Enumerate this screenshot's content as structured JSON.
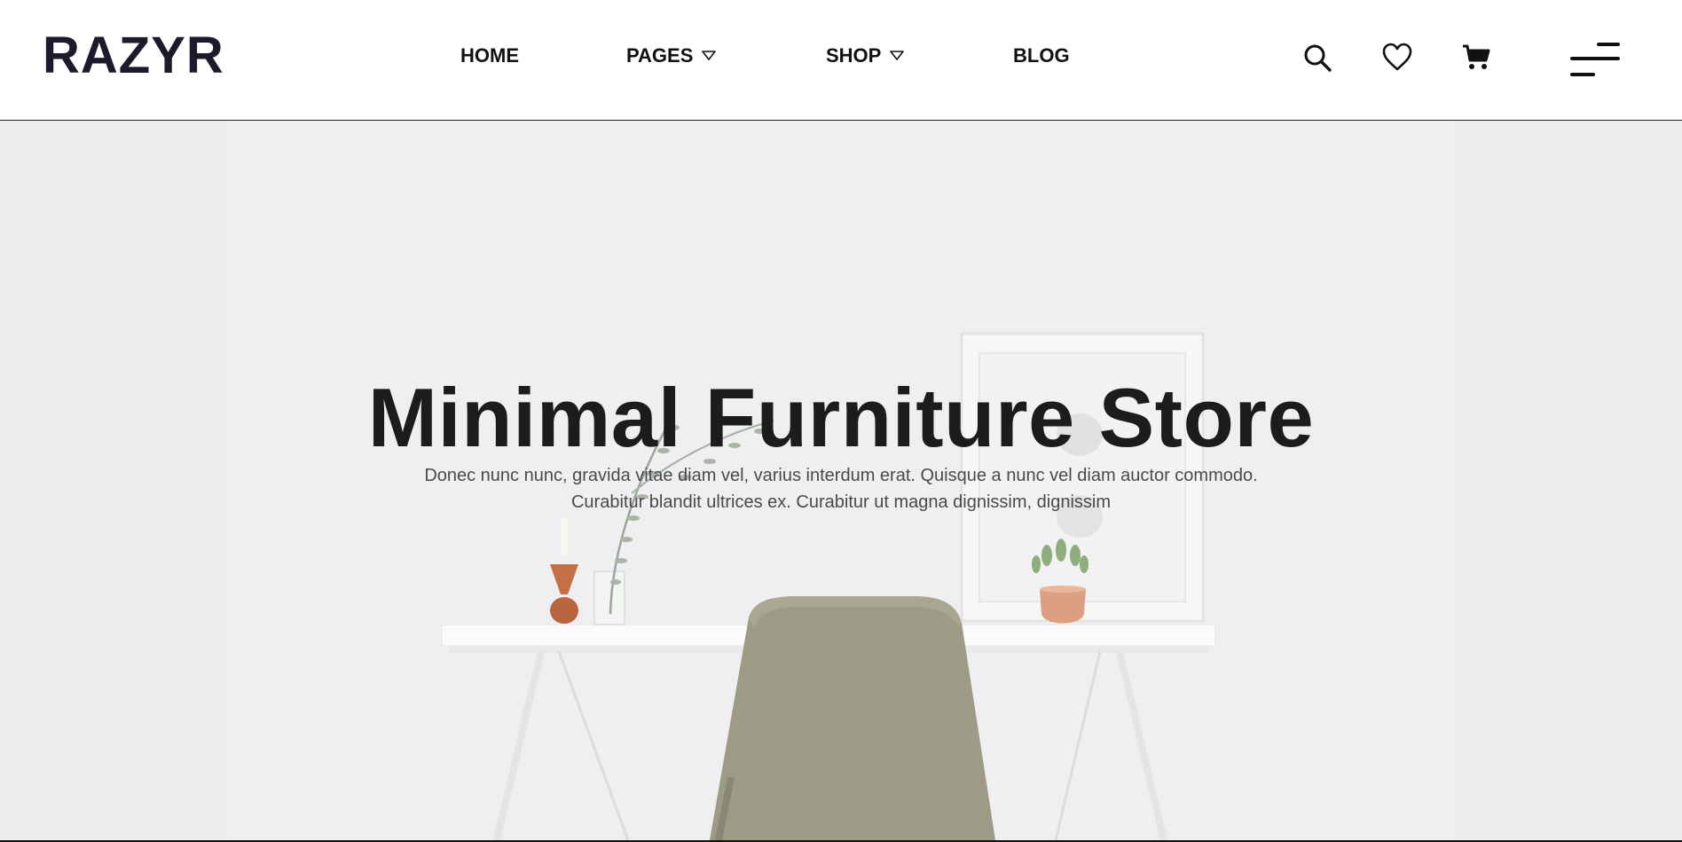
{
  "brand": {
    "logo_text": "RAZYR"
  },
  "nav": {
    "items": [
      {
        "label": "HOME"
      },
      {
        "label": "PAGES"
      },
      {
        "label": "SHOP"
      },
      {
        "label": "BLOG"
      }
    ]
  },
  "tools": {
    "icons": [
      "search-icon",
      "heart-icon",
      "cart-icon",
      "menu-icon"
    ]
  },
  "hero": {
    "title": "Minimal Furniture Store",
    "text_line1": "Donec nunc nunc, gravida vitae diam vel, varius interdum erat. Quisque a nunc vel diam auctor commodo.",
    "text_line2": "Curabitur blandit ultrices ex. Curabitur ut magna dignissim, dignissim"
  },
  "colors": {
    "logo": "#1b1b2b",
    "text": "#111111",
    "hero_bg": "#eeeef0",
    "chair": "#9d9a86",
    "vase": "#c0704a",
    "pot": "#d99a7a"
  }
}
